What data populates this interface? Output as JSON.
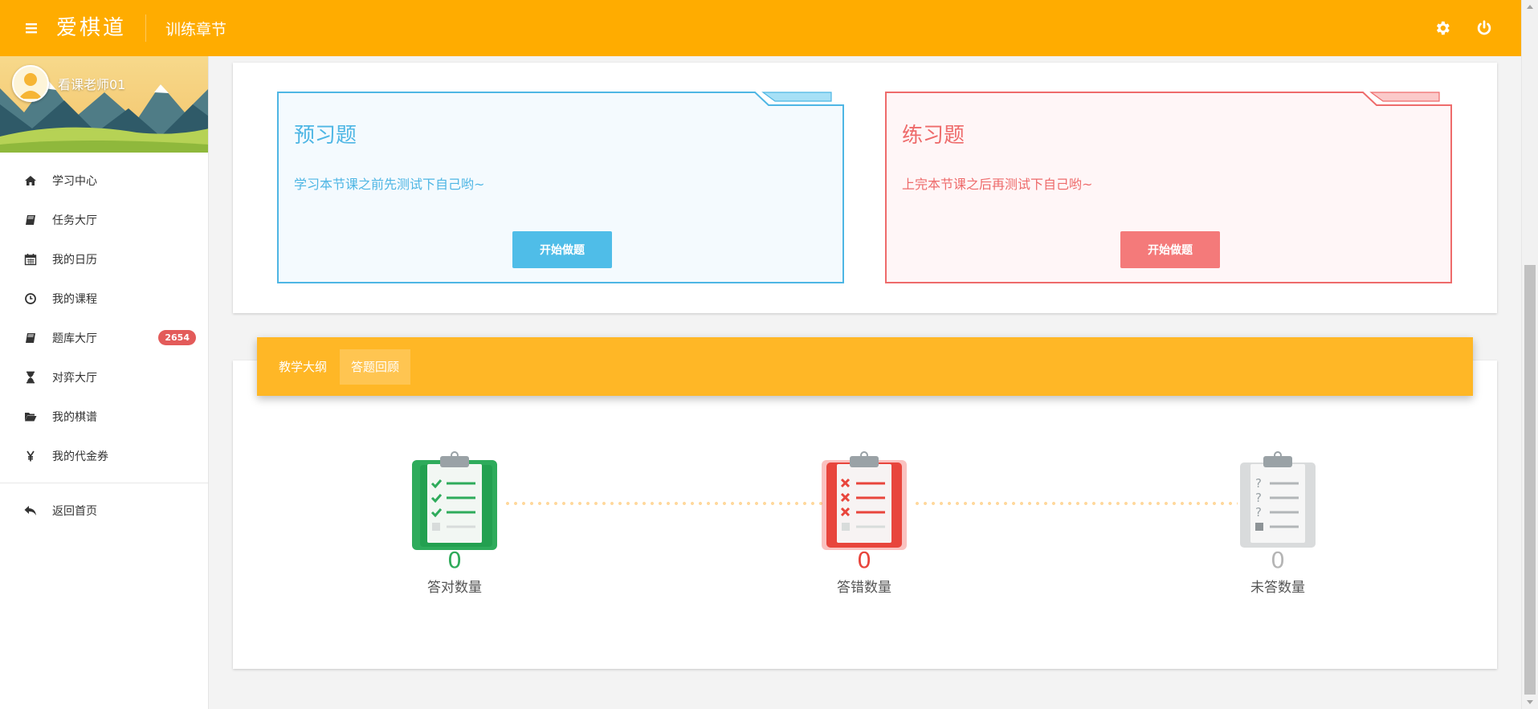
{
  "header": {
    "brand": "爱棋道",
    "breadcrumb": "训练章节",
    "bg_color": "#ffac00"
  },
  "sidebar": {
    "username": "看课老师01",
    "items": [
      {
        "label": "学习中心",
        "icon": "home-icon"
      },
      {
        "label": "任务大厅",
        "icon": "book-icon"
      },
      {
        "label": "我的日历",
        "icon": "calendar-icon"
      },
      {
        "label": "我的课程",
        "icon": "clock-icon"
      },
      {
        "label": "题库大厅",
        "icon": "book-icon",
        "badge": "2654"
      },
      {
        "label": "对弈大厅",
        "icon": "hourglass-icon"
      },
      {
        "label": "我的棋谱",
        "icon": "folder-open-icon"
      },
      {
        "label": "我的代金券",
        "icon": "yen-icon"
      }
    ],
    "back_home": {
      "label": "返回首页",
      "icon": "reply-icon"
    }
  },
  "preview_card": {
    "title": "预习题",
    "desc": "学习本节课之前先测试下自己哟~",
    "button": "开始做题",
    "color": "#4eb6e4"
  },
  "practice_card": {
    "title": "练习题",
    "desc": "上完本节课之后再测试下自己哟~",
    "button": "开始做题",
    "color": "#ee6b6b"
  },
  "tabs": [
    {
      "label": "教学大纲",
      "active": false
    },
    {
      "label": "答题回顾",
      "active": true
    }
  ],
  "stats": [
    {
      "value": "0",
      "label": "答对数量",
      "color": "#2faa5a",
      "icon": "clipboard-check-icon"
    },
    {
      "value": "0",
      "label": "答错数量",
      "color": "#e8453c",
      "icon": "clipboard-cross-icon"
    },
    {
      "value": "0",
      "label": "未答数量",
      "color": "#b5b5b5",
      "icon": "clipboard-question-icon"
    }
  ]
}
